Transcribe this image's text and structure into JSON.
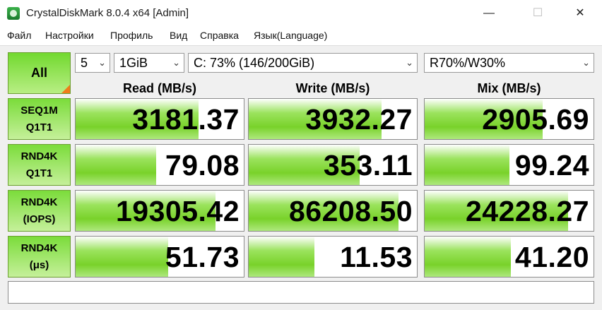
{
  "window": {
    "title": "CrystalDiskMark 8.0.4 x64 [Admin]",
    "minimize_glyph": "—",
    "maximize_glyph": "☐",
    "close_glyph": "✕"
  },
  "menu": [
    "Файл",
    "Настройки",
    "Профиль",
    "Вид",
    "Справка",
    "Язык(Language)"
  ],
  "controls": {
    "all_label": "All",
    "count": "5",
    "size": "1GiB",
    "drive": "C: 73% (146/200GiB)",
    "mix": "R70%/W30%"
  },
  "headers": {
    "read": "Read (MB/s)",
    "write": "Write (MB/s)",
    "mix": "Mix (MB/s)"
  },
  "rows": [
    {
      "line1": "SEQ1M",
      "line2": "Q1T1",
      "read": "3181.37",
      "write": "3932.27",
      "mix": "2905.69",
      "read_fill": 0.73,
      "write_fill": 0.79,
      "mix_fill": 0.7
    },
    {
      "line1": "RND4K",
      "line2": "Q1T1",
      "read": "79.08",
      "write": "353.11",
      "mix": "99.24",
      "read_fill": 0.48,
      "write_fill": 0.66,
      "mix_fill": 0.5
    },
    {
      "line1": "RND4K",
      "line2": "(IOPS)",
      "read": "19305.42",
      "write": "86208.50",
      "mix": "24228.27",
      "read_fill": 0.83,
      "write_fill": 0.89,
      "mix_fill": 0.85
    },
    {
      "line1": "RND4K",
      "line2": "(μs)",
      "read": "51.73",
      "write": "11.53",
      "mix": "41.20",
      "read_fill": 0.55,
      "write_fill": 0.39,
      "mix_fill": 0.51
    }
  ],
  "status_text": "",
  "colors": {
    "bar": "#79d22a",
    "button": "#7bdc3b",
    "corner": "#f07c1a"
  },
  "icons": {
    "app": "crystaldiskmark-app-icon",
    "dropdown": "chevron-down-icon"
  }
}
